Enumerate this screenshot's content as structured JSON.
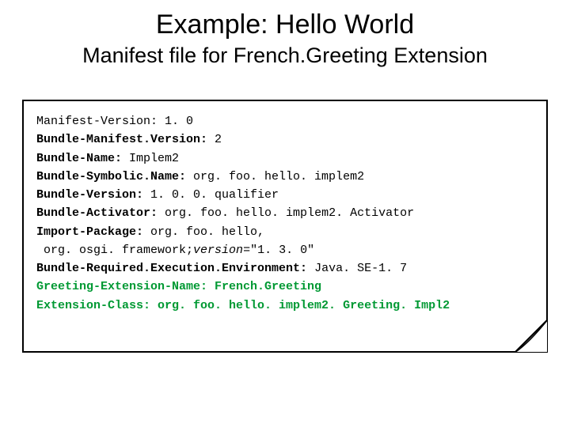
{
  "title": "Example: Hello World",
  "subtitle": "Manifest file for French.Greeting Extension",
  "manifest": {
    "lines": [
      {
        "key": "Manifest-Version:",
        "keyBold": false,
        "value": " 1. 0",
        "color": "black"
      },
      {
        "key": "Bundle-Manifest.Version:",
        "keyBold": true,
        "value": " 2",
        "color": "black"
      },
      {
        "key": "Bundle-Name:",
        "keyBold": true,
        "value": " Implem2",
        "color": "black"
      },
      {
        "key": "Bundle-Symbolic.Name:",
        "keyBold": true,
        "value": " org. foo. hello. implem2",
        "color": "black"
      },
      {
        "key": "Bundle-Version:",
        "keyBold": true,
        "value": " 1. 0. 0. qualifier",
        "color": "black"
      },
      {
        "key": "Bundle-Activator:",
        "keyBold": true,
        "value": " org. foo. hello. implem2. Activator",
        "color": "black"
      },
      {
        "key": "Import-Package:",
        "keyBold": true,
        "value": " org. foo. hello,",
        "color": "black"
      },
      {
        "key": "",
        "keyBold": false,
        "value": " org. osgi. framework;",
        "tail": "version",
        "tailItalic": true,
        "tailAfter": "=\"1. 3. 0\"",
        "color": "black"
      },
      {
        "key": "Bundle-Required.Execution.Environment:",
        "keyBold": true,
        "value": " Java. SE-1. 7",
        "color": "black"
      },
      {
        "key": "Greeting-Extension-Name: French.Greeting",
        "keyBold": true,
        "value": "",
        "color": "green"
      },
      {
        "key": "Extension-Class: org. foo. hello. implem2. Greeting. Impl2",
        "keyBold": true,
        "value": "",
        "color": "green"
      }
    ]
  }
}
